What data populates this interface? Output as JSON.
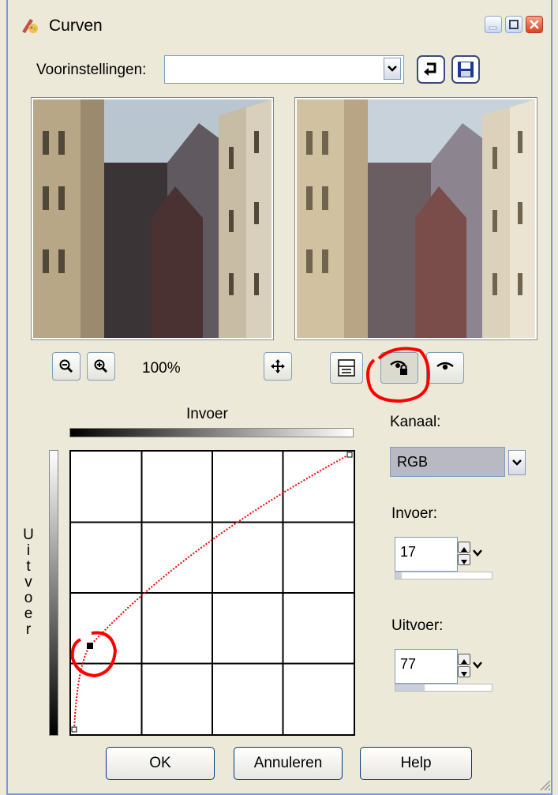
{
  "window": {
    "title": "Curven"
  },
  "presets": {
    "label": "Voorinstellingen:",
    "value": ""
  },
  "zoom": {
    "level": "100%"
  },
  "curve": {
    "input_label": "Invoer",
    "output_label_letters": [
      "U",
      "i",
      "t",
      "v",
      "o",
      "e",
      "r"
    ]
  },
  "channel": {
    "label": "Kanaal:",
    "value": "RGB"
  },
  "input_field": {
    "label": "Invoer:",
    "value": "17"
  },
  "output_field": {
    "label": "Uitvoer:",
    "value": "77"
  },
  "buttons": {
    "ok": "OK",
    "cancel": "Annuleren",
    "help": "Help"
  },
  "colors": {
    "frame_border": "#7a96df",
    "annotation_red": "#ff0000",
    "dialog_bg": "#ece9d8"
  },
  "icons": {
    "title": "paint-palette-icon",
    "reset": "undo-arrow-icon",
    "save": "floppy-disk-icon",
    "zoom_out": "zoom-out-icon",
    "zoom_in": "zoom-in-icon",
    "pan": "move-icon",
    "proof": "layers-icon",
    "auto_proof": "eye-lock-icon",
    "preview": "eye-icon"
  }
}
